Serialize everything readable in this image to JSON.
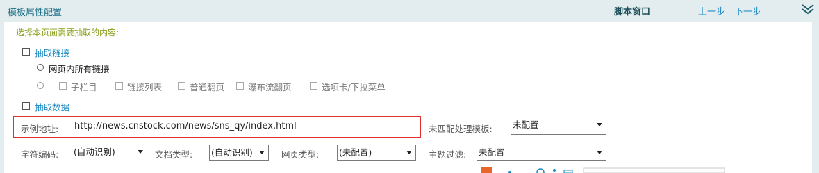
{
  "header": {
    "title": "模板属性配置",
    "script_window": "脚本窗口",
    "prev_step": "上一步",
    "next_step": "下一步",
    "collapse_icon": "double-chevron-down-icon"
  },
  "extract": {
    "prompt": "选择本页面需要抽取的内容:",
    "links_label": "抽取链接",
    "all_links_label": "网页内所有链接",
    "sub_options": [
      "子栏目",
      "链接列表",
      "普通翻页",
      "瀑布流翻页",
      "选项卡/下拉菜单"
    ],
    "data_label": "抽取数据"
  },
  "example": {
    "label": "示例地址:",
    "url": "http://news.cnstock.com/news/sns_qy/index.html",
    "unmatched_label": "未匹配处理模板:",
    "unmatched_value": "未配置"
  },
  "settings": {
    "charset_label": "字符编码:",
    "charset_value": "(自动识别)",
    "doctype_label": "文档类型:",
    "doctype_value": "(自动识别)",
    "pagetype_label": "网页类型:",
    "pagetype_value": "(未配置)",
    "topic_label": "主题过滤:",
    "topic_value": "未配置"
  },
  "colors": {
    "accent": "#1a88c2",
    "title": "#1a6e86",
    "prompt": "#8aa01c",
    "highlight": "#e03030",
    "background": "#e3ecee"
  }
}
